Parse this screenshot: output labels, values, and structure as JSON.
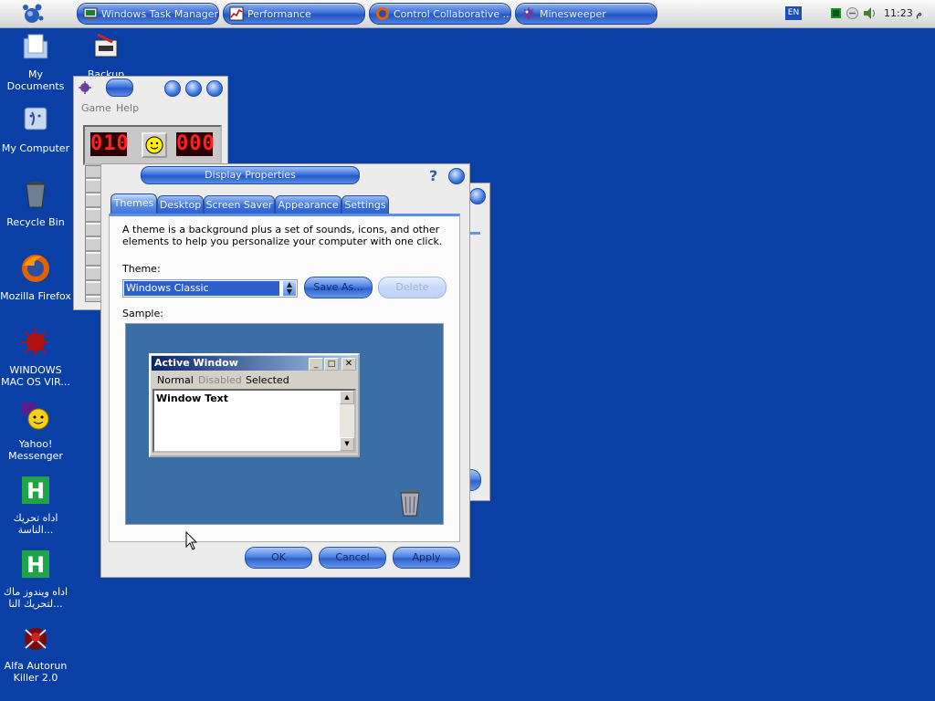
{
  "taskbar": {
    "buttons": [
      {
        "label": "Windows Task Manager",
        "icon": "task-manager-icon"
      },
      {
        "label": "Performance",
        "icon": "performance-icon"
      },
      {
        "label": "Control Collaborative ...",
        "icon": "firefox-icon"
      },
      {
        "label": "Minesweeper",
        "icon": "minesweeper-icon"
      }
    ],
    "language": "EN",
    "clock": "11:23 م"
  },
  "desktop_icons": [
    {
      "label": "My Documents",
      "icon": "my-documents-icon"
    },
    {
      "label": "Backup",
      "icon": "backup-icon"
    },
    {
      "label": "My Computer",
      "icon": "my-computer-icon"
    },
    {
      "label": "Recycle Bin",
      "icon": "recycle-bin-icon"
    },
    {
      "label": "Mozilla Firefox",
      "icon": "firefox-icon"
    },
    {
      "label": "WINDOWS MAC OS VIR...",
      "icon": "virus-icon"
    },
    {
      "label": "Yahoo! Messenger",
      "icon": "yahoo-messenger-icon"
    },
    {
      "label": "اداه تحريك الناسة...",
      "icon": "h-app-icon"
    },
    {
      "label": "اداه ويندوز ماك لتحريك النا...",
      "icon": "h-app-icon"
    },
    {
      "label": "Alfa Autorun Killer 2.0",
      "icon": "autorun-killer-icon"
    }
  ],
  "minesweeper": {
    "menu": [
      "Game",
      "Help"
    ],
    "mine_counter": "010",
    "timer": "000"
  },
  "display_properties": {
    "title": "Display Properties",
    "tabs": [
      "Themes",
      "Desktop",
      "Screen Saver",
      "Appearance",
      "Settings"
    ],
    "active_tab": "Themes",
    "description": "A theme is a background plus a set of sounds, icons, and other elements to help you personalize your computer with one click.",
    "theme_label": "Theme:",
    "theme_value": "Windows Classic",
    "save_as": "Save As...",
    "delete": "Delete",
    "sample_label": "Sample:",
    "sample": {
      "window_title": "Active Window",
      "menu": [
        "Normal",
        "Disabled",
        "Selected"
      ],
      "window_text": "Window Text"
    },
    "ok": "OK",
    "cancel": "Cancel",
    "apply": "Apply"
  },
  "colors": {
    "desktop": "#0a3fa5",
    "sample_bg": "#3a6ea5",
    "accent": "#2d60cb"
  }
}
